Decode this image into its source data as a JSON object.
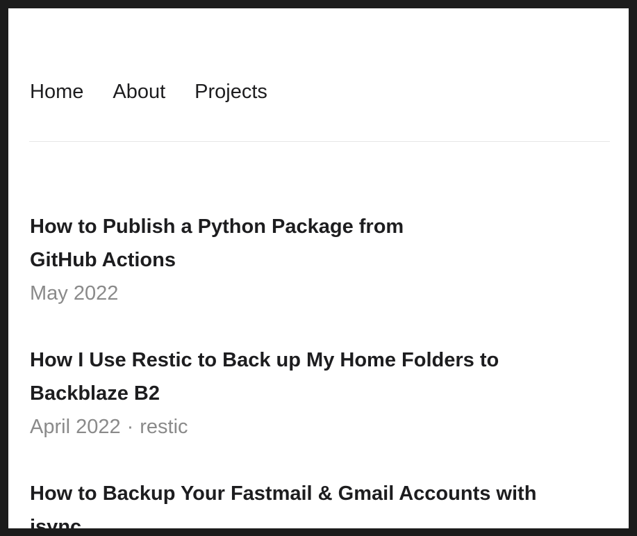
{
  "nav": {
    "items": [
      {
        "label": "Home"
      },
      {
        "label": "About"
      },
      {
        "label": "Projects"
      }
    ]
  },
  "posts": [
    {
      "title": "How to Publish a Python Package from GitHub Actions",
      "date": "May 2022",
      "tag": ""
    },
    {
      "title": "How I Use Restic to Back up My Home Folders to Backblaze B2",
      "date": "April 2022",
      "separator": "·",
      "tag": "restic"
    },
    {
      "title": "How to Backup Your Fastmail & Gmail Accounts with isync",
      "date": "",
      "tag": ""
    }
  ],
  "colors": {
    "frame": "#1c1c1c",
    "background": "#ffffff",
    "text": "#1d1d1f",
    "muted": "#8a8a8a",
    "divider": "#e6e6e6"
  }
}
